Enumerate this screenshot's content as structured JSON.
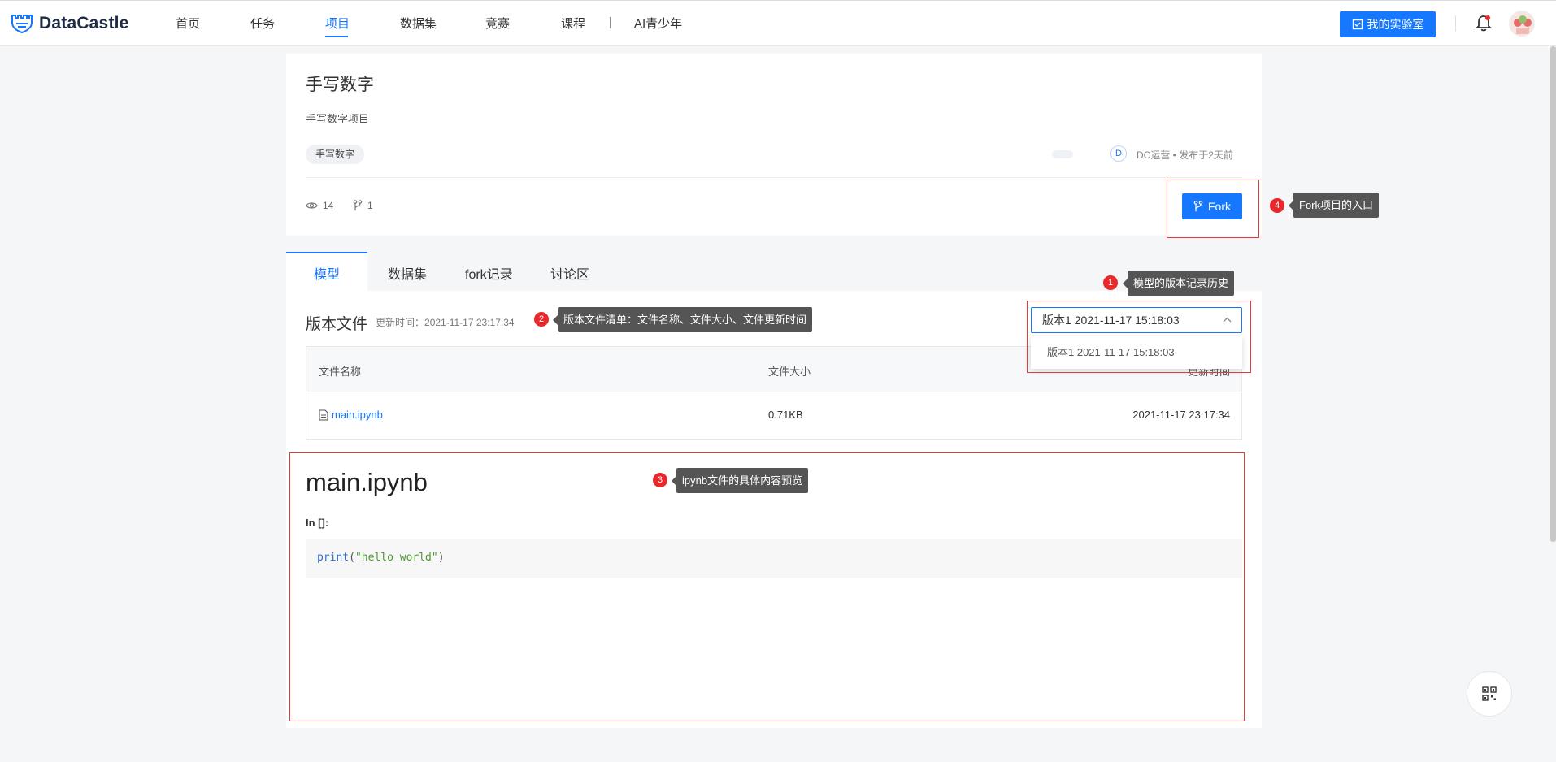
{
  "header": {
    "logo_text": "DataCastle",
    "nav": [
      "首页",
      "任务",
      "项目",
      "数据集",
      "竞赛",
      "课程"
    ],
    "nav_separator": "|",
    "nav_extra": "AI青少年",
    "lab_button": "我的实验室"
  },
  "project": {
    "title": "手写数字",
    "description": "手写数字项目",
    "tag": "手写数字",
    "author_initial": "D",
    "author_line": "DC运营 • 发布于2天前",
    "views": "14",
    "forks": "1",
    "fork_button": "Fork"
  },
  "tabs": [
    "模型",
    "数据集",
    "fork记录",
    "讨论区"
  ],
  "version_files": {
    "title": "版本文件",
    "updated_label": "更新时间：",
    "updated_value": "2021-11-17 23:17:34",
    "selected_version": "版本1 2021-11-17 15:18:03",
    "dropdown_option": "版本1 2021-11-17 15:18:03",
    "columns": [
      "文件名称",
      "文件大小",
      "更新时间"
    ],
    "rows": [
      {
        "name": "main.ipynb",
        "size": "0.71KB",
        "updated": "2021-11-17 23:17:34"
      }
    ]
  },
  "notebook": {
    "title": "main.ipynb",
    "prompt": "In []:",
    "code_keyword": "print",
    "code_open": "(",
    "code_string": "\"hello world\"",
    "code_close": ")"
  },
  "annotations": [
    {
      "num": "1",
      "text": "模型的版本记录历史"
    },
    {
      "num": "2",
      "text": "版本文件清单：文件名称、文件大小、文件更新时间"
    },
    {
      "num": "3",
      "text": "ipynb文件的具体内容预览"
    },
    {
      "num": "4",
      "text": "Fork项目的入口"
    }
  ],
  "colors": {
    "primary": "#1677ff",
    "annotation_red": "#e23b3b",
    "tooltip_bg": "#555555"
  }
}
